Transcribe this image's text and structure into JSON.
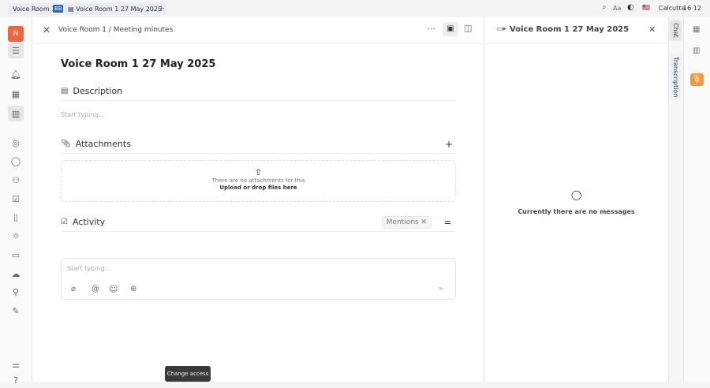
{
  "tabs": {
    "workspace": "Voice Room 1",
    "badge": "BB",
    "doc": "Voice Room 1 27 May 2025",
    "add": "+"
  },
  "topbar": {
    "font": "Aa",
    "location": "Calcutta",
    "time": "16 12"
  },
  "sidebar": {
    "avatar": "N"
  },
  "main": {
    "breadcrumb": "Voice Room 1 / Meeting minutes",
    "title": "Voice Room 1 27 May 2025",
    "description_label": "Description",
    "description_placeholder": "Start typing...",
    "attachments_label": "Attachments",
    "no_attachments": "There are no attachments for this",
    "upload": "Upload or drop files here",
    "activity_label": "Activity",
    "mentions_filter": "Mentions",
    "comment_placeholder": "Start typing..."
  },
  "right": {
    "title": "Voice Room 1 27 May 2025",
    "empty": "Currently there are no messages"
  },
  "vtabs": {
    "chat": "Chat",
    "transcription": "Transcription"
  },
  "tooltip": "Change access",
  "colors": {
    "accent": "#f0673f",
    "mic": "#f49a3c",
    "badge": "#2f63b6"
  }
}
